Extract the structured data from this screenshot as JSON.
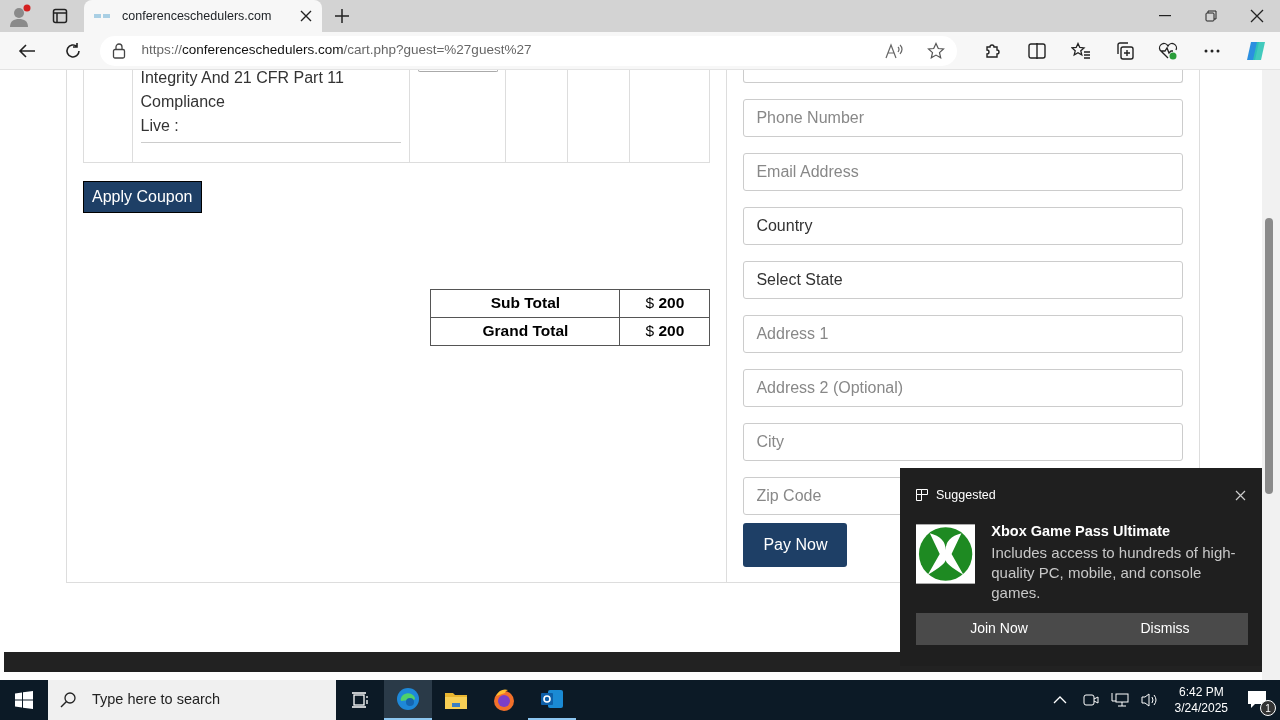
{
  "browser": {
    "tab_title": "conferenceschedulers.com",
    "url_scheme": "https://",
    "url_host": "conferenceschedulers.com",
    "url_path": "/cart.php?guest=%27guest%27"
  },
  "cart": {
    "item_title": "Integrity And 21 CFR Part 11 Compliance",
    "item_mode": "Live :"
  },
  "apply_coupon": "Apply Coupon",
  "totals": [
    {
      "label": "Sub Total",
      "currency": "$",
      "amount": "200"
    },
    {
      "label": "Grand Total",
      "currency": "$",
      "amount": "200"
    }
  ],
  "fields": [
    {
      "kind": "cut"
    },
    {
      "kind": "input",
      "placeholder": "Phone Number"
    },
    {
      "kind": "input",
      "placeholder": "Email Address"
    },
    {
      "kind": "select",
      "value": "Country"
    },
    {
      "kind": "select",
      "value": "Select State"
    },
    {
      "kind": "input",
      "placeholder": "Address 1"
    },
    {
      "kind": "input",
      "placeholder": "Address 2 (Optional)"
    },
    {
      "kind": "input",
      "placeholder": "City"
    },
    {
      "kind": "input",
      "placeholder": "Zip Code"
    }
  ],
  "pay_now": "Pay Now",
  "toast": {
    "header": "Suggested",
    "title": "Xbox Game Pass Ultimate",
    "body": "Includes access to hundreds of high-quality PC, mobile, and console games.",
    "buttons": [
      "Join Now",
      "Dismiss"
    ]
  },
  "taskbar": {
    "search_placeholder": "Type here to search",
    "time": "6:42 PM",
    "date": "3/24/2025",
    "notification_count": "1"
  }
}
